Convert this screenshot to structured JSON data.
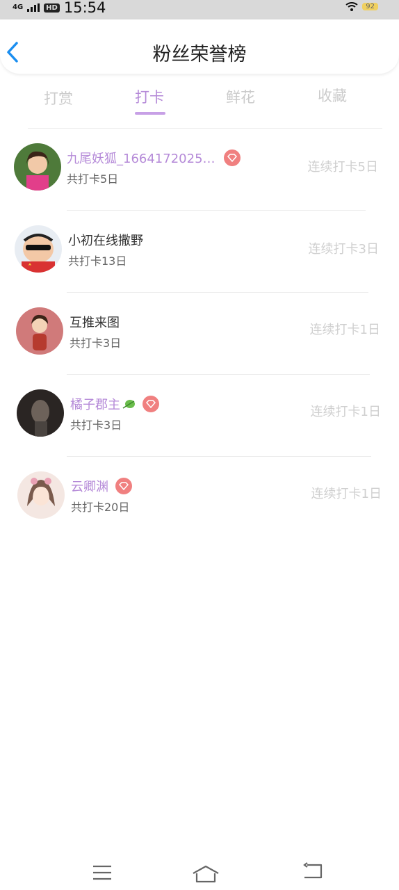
{
  "status_bar": {
    "network": "4G",
    "hd": "HD",
    "time": "15:54",
    "battery": "92"
  },
  "header": {
    "title": "粉丝荣誉榜",
    "back_icon": "chevron-left-icon",
    "accent_color": "#1a8ef0"
  },
  "tabs": [
    {
      "label": "打赏",
      "active": false
    },
    {
      "label": "打卡",
      "active": true
    },
    {
      "label": "鲜花",
      "active": false
    },
    {
      "label": "收藏",
      "active": false
    }
  ],
  "fans": [
    {
      "name": "九尾妖狐_1664172025…",
      "total": "共打卡5日",
      "streak": "连续打卡5日",
      "vip": true,
      "badges": [
        "diamond-icon"
      ]
    },
    {
      "name": "小初在线撒野",
      "total": "共打卡13日",
      "streak": "连续打卡3日",
      "vip": false,
      "badges": []
    },
    {
      "name": "互推来图",
      "total": "共打卡3日",
      "streak": "连续打卡1日",
      "vip": false,
      "badges": []
    },
    {
      "name": "橘子郡主",
      "total": "共打卡3日",
      "streak": "连续打卡1日",
      "vip": true,
      "badges": [
        "leaf-icon",
        "diamond-icon"
      ]
    },
    {
      "name": "云卿渊",
      "total": "共打卡20日",
      "streak": "连续打卡1日",
      "vip": true,
      "badges": [
        "diamond-icon"
      ]
    }
  ],
  "colors": {
    "vip_name": "#b58ad8",
    "tab_active": "#b58ad8",
    "tab_inactive": "#cbcbcb",
    "diamond_badge": "#f08080",
    "streak_text": "#cfcfcf"
  },
  "nav_bar": {
    "icons": [
      "menu-icon",
      "home-icon",
      "back-icon"
    ]
  }
}
